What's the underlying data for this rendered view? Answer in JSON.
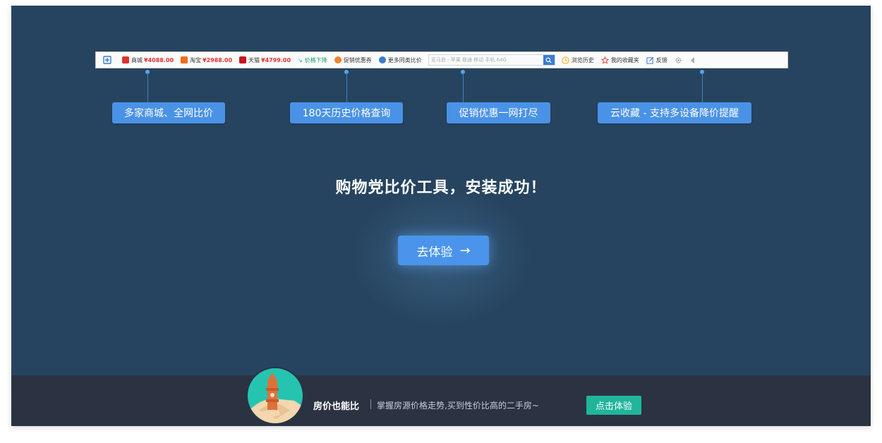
{
  "toolbar": {
    "logo_icon": "price-compare-logo-icon",
    "items": [
      {
        "name": "商城",
        "price": "¥4088.00",
        "color": "#e0322c"
      },
      {
        "name": "淘宝",
        "price": "¥2988.00",
        "color": "#f46b1d"
      },
      {
        "name": "天猫",
        "price": "¥4799.00",
        "color": "#c8161d"
      }
    ],
    "price_drop": "价格下降",
    "coupon": "促销优惠券",
    "more_compare": "更多同类比价",
    "search_placeholder": "亚马逊 - 苹果 联通 移动 手机 64G",
    "history": "浏览历史",
    "favorites": "我的收藏夹",
    "feedback": "反馈"
  },
  "features": [
    "多家商城、全网比价",
    "180天历史价格查询",
    "促销优惠一网打尽",
    "云收藏 - 支持多设备降价提醒"
  ],
  "headline": "购物党比价工具，安装成功！",
  "cta": {
    "label": "去体验",
    "arrow": "→"
  },
  "banner": {
    "brand": "房价也能比",
    "text": "掌握房源价格走势,买到性价比高的二手房~",
    "button": "点击体验"
  },
  "colors": {
    "background": "#26445f",
    "accent": "#4a94ec",
    "banner_bg": "#2b3342",
    "banner_button": "#21b59c"
  }
}
